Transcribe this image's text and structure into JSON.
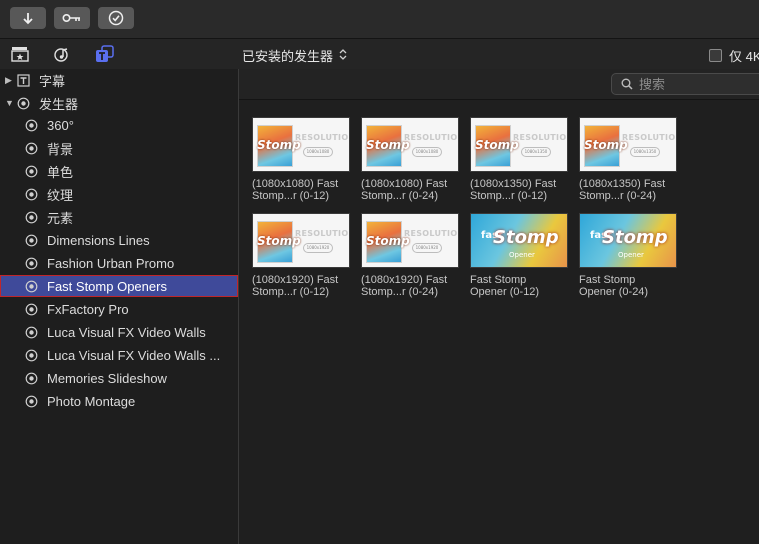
{
  "toolbar": {
    "buttons": [
      {
        "name": "import-button",
        "icon": "download-arrow-icon"
      },
      {
        "name": "keywords-button",
        "icon": "key-icon"
      },
      {
        "name": "approve-button",
        "icon": "checkmark-circle-icon"
      }
    ]
  },
  "header": {
    "library_icons": [
      "clapper-icon",
      "music-note-icon",
      "titles-generators-icon"
    ],
    "title": "已安装的发生器",
    "only4k_label": "仅 4K"
  },
  "sidebar": {
    "groups": [
      {
        "label": "字幕",
        "expanded": false
      },
      {
        "label": "发生器",
        "expanded": true
      }
    ],
    "items": [
      {
        "label": "360°"
      },
      {
        "label": "背景"
      },
      {
        "label": "单色"
      },
      {
        "label": "纹理"
      },
      {
        "label": "元素"
      },
      {
        "label": "Dimensions Lines"
      },
      {
        "label": "Fashion Urban Promo"
      },
      {
        "label": "Fast Stomp Openers"
      },
      {
        "label": "FxFactory Pro"
      },
      {
        "label": "Luca Visual FX Video Walls"
      },
      {
        "label": "Luca Visual FX Video Walls ..."
      },
      {
        "label": "Memories Slideshow"
      },
      {
        "label": "Photo Montage"
      }
    ],
    "selected_index": 7
  },
  "search": {
    "placeholder": "搜索",
    "value": ""
  },
  "thumb_text": {
    "resolution": "RESOLUTION",
    "stomp": "Stomp",
    "fast": "fast",
    "opener": "Opener",
    "pills": [
      "1080x1080",
      "1080x1080",
      "1080x1350",
      "1080x1350",
      "1080x1920",
      "1080x1920"
    ]
  },
  "tiles": [
    {
      "line1": "(1080x1080) Fast",
      "line2": "Stomp...r (0-12)"
    },
    {
      "line1": "(1080x1080) Fast",
      "line2": "Stomp...r (0-24)"
    },
    {
      "line1": "(1080x1350) Fast",
      "line2": "Stomp...r (0-12)"
    },
    {
      "line1": "(1080x1350) Fast",
      "line2": "Stomp...r (0-24)"
    },
    {
      "line1": "(1080x1920) Fast",
      "line2": "Stomp...r (0-12)"
    },
    {
      "line1": "(1080x1920) Fast",
      "line2": "Stomp...r (0-24)"
    },
    {
      "line1": "Fast Stomp",
      "line2": "Opener (0-12)"
    },
    {
      "line1": "Fast Stomp",
      "line2": "Opener (0-24)"
    }
  ],
  "colors": {
    "selection": "#3f4a9a",
    "selection_border": "#c0262a",
    "accent_line": "#4a50b8"
  }
}
